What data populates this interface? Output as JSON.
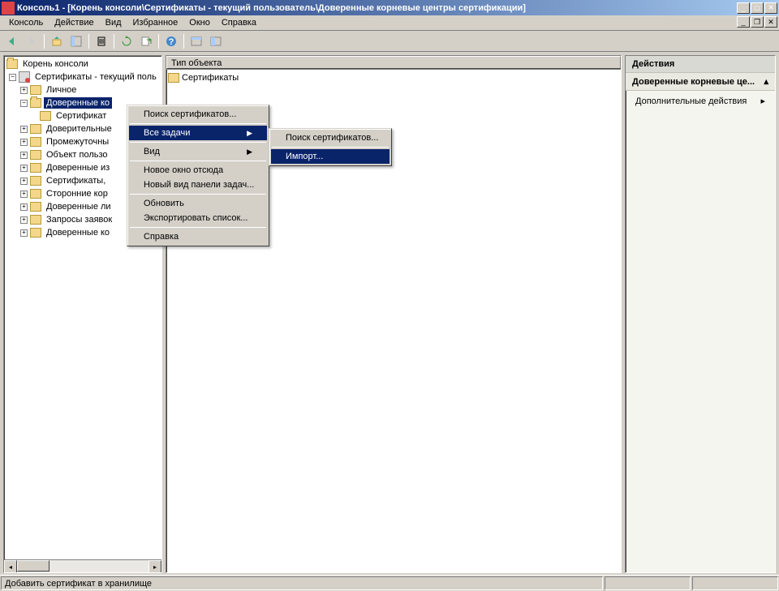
{
  "window": {
    "title": "Консоль1 - [Корень консоли\\Сертификаты - текущий пользователь\\Доверенные корневые центры сертификации]"
  },
  "menubar": [
    "Консоль",
    "Действие",
    "Вид",
    "Избранное",
    "Окно",
    "Справка"
  ],
  "tree": {
    "root": "Корень консоли",
    "certs": "Сертификаты - текущий поль",
    "items": [
      "Личное",
      "Доверенные ко",
      "Сертификат",
      "Доверительные",
      "Промежуточны",
      "Объект пользо",
      "Доверенные из",
      "Сертификаты, ",
      "Сторонние кор",
      "Доверенные ли",
      "Запросы заявок",
      "Доверенные ко"
    ]
  },
  "list": {
    "header": "Тип объекта",
    "row": "Сертификаты"
  },
  "actions": {
    "title": "Действия",
    "subtitle": "Доверенные корневые це...",
    "item": "Дополнительные действия"
  },
  "context_menu": {
    "items": [
      "Поиск сертификатов...",
      "Все задачи",
      "Вид",
      "Новое окно отсюда",
      "Новый вид панели задач...",
      "Обновить",
      "Экспортировать список...",
      "Справка"
    ]
  },
  "submenu": {
    "items": [
      "Поиск сертификатов...",
      "Импорт..."
    ]
  },
  "statusbar": "Добавить сертификат в хранилище"
}
